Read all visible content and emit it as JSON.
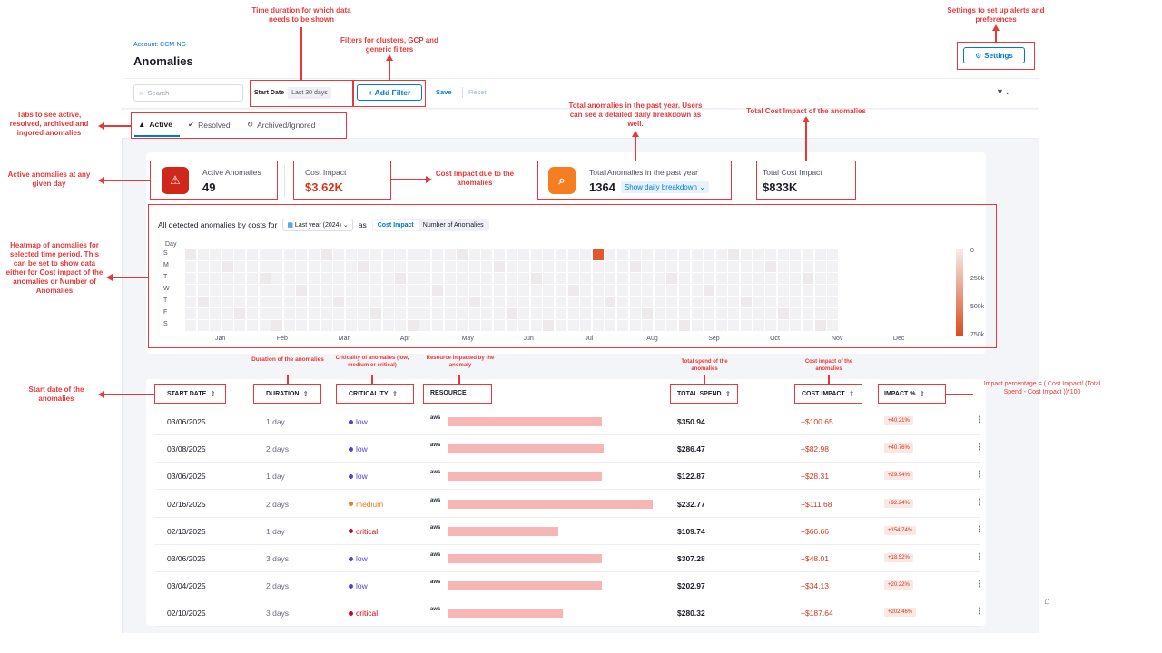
{
  "header": {
    "account": "Account: CCM-NG",
    "title": "Anomalies",
    "settings_label": "Settings"
  },
  "filters": {
    "search_placeholder": "Search",
    "start_date_label": "Start Date",
    "start_date_value": "Last 30 days",
    "add_filter_label": "+ Add Filter",
    "save_label": "Save",
    "reset_label": "Reset"
  },
  "tabs": [
    {
      "label": "Active"
    },
    {
      "label": "Resolved"
    },
    {
      "label": "Archived/Ignored"
    }
  ],
  "summary": {
    "active_label": "Active Anomalies",
    "active_value": "49",
    "cost_label": "Cost Impact",
    "cost_value": "$3.62K",
    "total_label": "Total Anomalies in the past year",
    "total_value": "1364",
    "breakdown_label": "Show daily breakdown",
    "total_cost_label": "Total Cost Impact",
    "total_cost_value": "$833K"
  },
  "heatmap": {
    "title": "All detected anomalies by costs for",
    "period": "Last year (2024)",
    "as_label": "as",
    "toggle_cost": "Cost Impact",
    "toggle_count": "Number of Anomalies",
    "day_header": "Day",
    "days": [
      "S",
      "M",
      "T",
      "W",
      "T",
      "F",
      "S"
    ],
    "months": [
      "Jan",
      "Feb",
      "Mar",
      "Apr",
      "May",
      "Jun",
      "Jul",
      "Aug",
      "Sep",
      "Oct",
      "Nov",
      "Dec"
    ],
    "legend": [
      "0",
      "250k",
      "500k",
      "750k"
    ],
    "highlight": {
      "week": 33,
      "day": 0,
      "level": 1.0
    },
    "colors": {
      "empty": "#f2f1f4",
      "light": "#eeeaec",
      "high": "#e0582b"
    }
  },
  "table": {
    "headers": [
      "START DATE",
      "DURATION",
      "CRITICALITY",
      "RESOURCE",
      "TOTAL SPEND",
      "COST IMPACT",
      "IMPACT %"
    ],
    "rows": [
      {
        "date": "03/06/2025",
        "duration": "1 day",
        "criticality": "low",
        "resource_share": 0.75,
        "spend": "$350.94",
        "impact": "+$100.65",
        "pct": "+40.21%"
      },
      {
        "date": "03/08/2025",
        "duration": "2 days",
        "criticality": "low",
        "resource_share": 0.76,
        "spend": "$286.47",
        "impact": "+$82.98",
        "pct": "+40.76%"
      },
      {
        "date": "03/06/2025",
        "duration": "1 day",
        "criticality": "low",
        "resource_share": 0.75,
        "spend": "$122.87",
        "impact": "+$28.31",
        "pct": "+29.94%"
      },
      {
        "date": "02/16/2025",
        "duration": "2 days",
        "criticality": "medium",
        "resource_share": 1.0,
        "spend": "$232.77",
        "impact": "+$111.68",
        "pct": "+92.24%"
      },
      {
        "date": "02/13/2025",
        "duration": "1 day",
        "criticality": "critical",
        "resource_share": 0.54,
        "spend": "$109.74",
        "impact": "+$66.66",
        "pct": "+154.74%"
      },
      {
        "date": "03/06/2025",
        "duration": "3 days",
        "criticality": "low",
        "resource_share": 0.75,
        "spend": "$307.28",
        "impact": "+$48.01",
        "pct": "+18.52%"
      },
      {
        "date": "03/04/2025",
        "duration": "2 days",
        "criticality": "low",
        "resource_share": 0.75,
        "spend": "$202.97",
        "impact": "+$34.13",
        "pct": "+20.22%"
      },
      {
        "date": "02/10/2025",
        "duration": "3 days",
        "criticality": "critical",
        "resource_share": 0.56,
        "spend": "$280.32",
        "impact": "+$187.64",
        "pct": "+202.46%"
      }
    ],
    "criticality_colors": {
      "low": "#5b3fd1",
      "medium": "#f07a1e",
      "critical": "#d0021b"
    },
    "resource_icon": "aws"
  },
  "annotations": {
    "time_duration": "Time duration for which data needs to be shown",
    "filters": "Filters for clusters, GCP and generic filters",
    "settings": "Settings to set up alerts and preferences",
    "tabs": "Tabs to see active, resolved, archived and ingored anomalies",
    "active": "Active anomalies at any given day",
    "cost_impact": "Cost Impact due to the anomalies",
    "total_anomalies": "Total anomalies in the past year. Users can see a detailed daily breakdown as well.",
    "total_cost": "Total Cost Impact of the anomalies",
    "heatmap": "Heatmap of anomalies for selected time period. This can be set to show data either for Cost impact of the anomalies or Number of Anomalies",
    "start_date": "Start date of the anomalies",
    "duration": "Duration of the anomalies",
    "criticality": "Criticality of anomalies (low, medium or critical)",
    "resource": "Resource impacted by the anomaly",
    "total_spend": "Total spend of the anomalies",
    "cost_impact_col": "Cost impact of the anomalies",
    "impact_pct": "Impact percentage = ( Cost Impact/ (Total Spend - Cost Impact ))*100"
  }
}
